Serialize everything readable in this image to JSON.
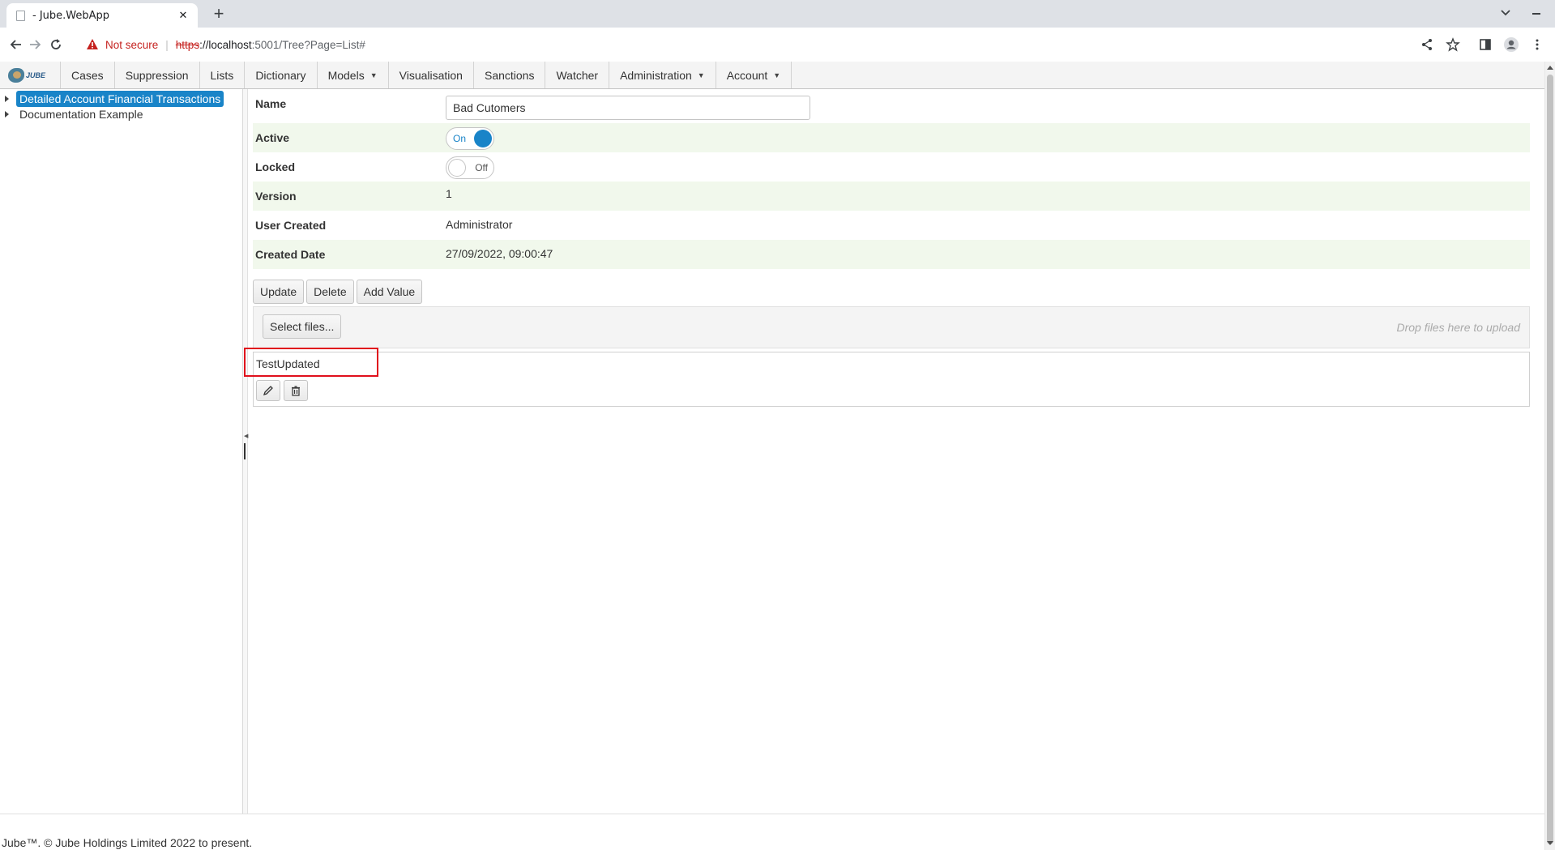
{
  "browser": {
    "tab_title": "- Jube.WebApp",
    "security_label": "Not secure",
    "url_scheme": "https",
    "url_host": "://localhost",
    "url_rest": ":5001/Tree?Page=List#"
  },
  "app": {
    "logo_text": "JUBE",
    "nav": [
      {
        "label": "Cases"
      },
      {
        "label": "Suppression"
      },
      {
        "label": "Lists"
      },
      {
        "label": "Dictionary"
      },
      {
        "label": "Models"
      },
      {
        "label": "Visualisation"
      },
      {
        "label": "Sanctions"
      },
      {
        "label": "Watcher"
      },
      {
        "label": "Administration"
      },
      {
        "label": "Account"
      }
    ]
  },
  "tree": {
    "items": [
      {
        "label": "Detailed Account Financial Transactions",
        "selected": true
      },
      {
        "label": "Documentation Example",
        "selected": false
      }
    ]
  },
  "form": {
    "name_label": "Name",
    "name_value": "Bad Cutomers",
    "active_label": "Active",
    "active_state": "On",
    "locked_label": "Locked",
    "locked_state": "Off",
    "version_label": "Version",
    "version_value": "1",
    "user_created_label": "User Created",
    "user_created_value": "Administrator",
    "created_date_label": "Created Date",
    "created_date_value": "27/09/2022, 09:00:47"
  },
  "actions": {
    "update": "Update",
    "delete": "Delete",
    "add_value": "Add Value"
  },
  "upload": {
    "select_files": "Select files...",
    "drop_hint": "Drop files here to upload"
  },
  "list_values": [
    {
      "value": "TestUpdated",
      "edit_icon": "pencil-icon",
      "delete_icon": "trash-icon"
    }
  ],
  "footer": {
    "text": "Jube™. © Jube Holdings Limited 2022 to present."
  },
  "colors": {
    "accent": "#1984c8",
    "row_alt": "#f1f8ec",
    "highlight": "#e0101c",
    "warning": "#c5221f"
  }
}
